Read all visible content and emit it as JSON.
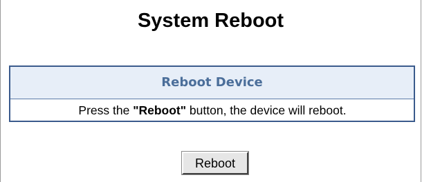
{
  "page": {
    "title": "System Reboot"
  },
  "panel": {
    "header": "Reboot Device",
    "message_prefix": "Press the ",
    "message_emphasis": "\"Reboot\"",
    "message_suffix": " button, the device will reboot."
  },
  "actions": {
    "reboot_label": "Reboot"
  }
}
